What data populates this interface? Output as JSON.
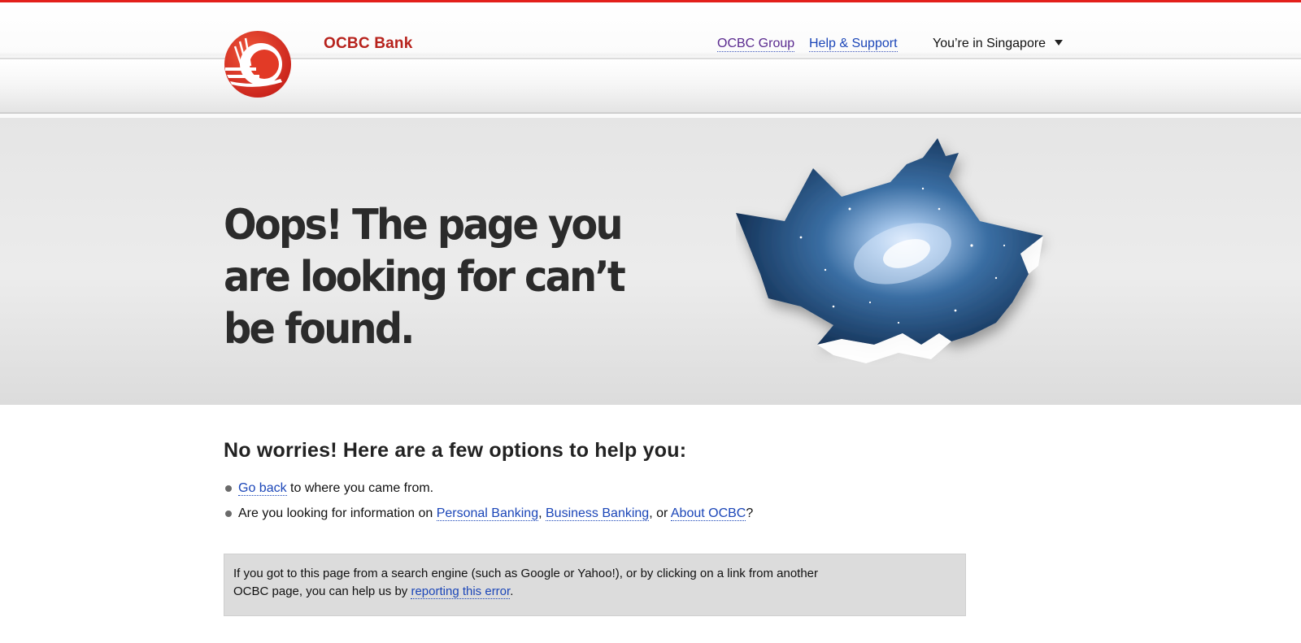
{
  "brand": {
    "name": "OCBC Bank",
    "accent_color": "#e3201b",
    "logo_icon": "ocbc-junk-sail-logo"
  },
  "header_nav": {
    "group_link": "OCBC Group",
    "help_link": "Help & Support",
    "region_selector": "You’re in Singapore",
    "region_icon": "caret-down-icon"
  },
  "hero": {
    "title": "Oops! The page you are looking for can’t be found.",
    "illustration_icon": "torn-paper-galaxy-image"
  },
  "options": {
    "heading": "No worries! Here are a few options to help you:",
    "item1": {
      "link": "Go back",
      "text": " to where you came from."
    },
    "item2": {
      "prefix": "Are you looking for information on ",
      "link_personal": "Personal Banking",
      "sep1": ", ",
      "link_business": "Business Banking",
      "sep2": ", or ",
      "link_about": "About OCBC",
      "suffix": "?"
    }
  },
  "notice": {
    "text": "If you got to this page from a search engine (such as Google or Yahoo!), or by clicking on a link from another OCBC page, you can help us by ",
    "link": "reporting this error",
    "suffix": "."
  }
}
